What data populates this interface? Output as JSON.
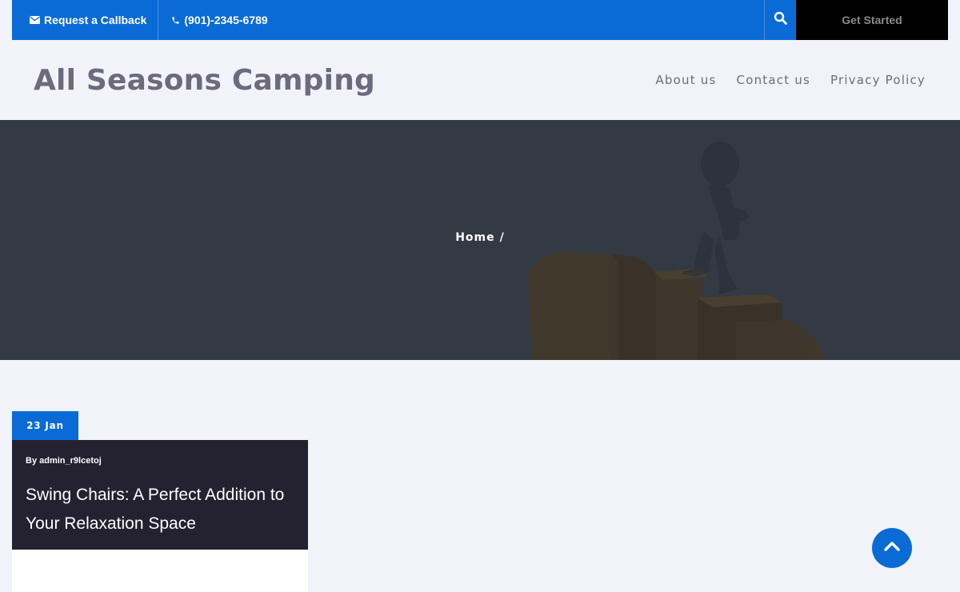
{
  "topbar": {
    "callback_label": "Request a Callback",
    "phone_label": "(901)-2345-6789",
    "cta_label": "Get Started"
  },
  "header": {
    "site_title": "All Seasons Camping",
    "nav": [
      {
        "label": "About us"
      },
      {
        "label": "Contact us"
      },
      {
        "label": "Privacy Policy"
      }
    ]
  },
  "hero": {
    "breadcrumb": {
      "home": "Home",
      "separator": "/"
    }
  },
  "post": {
    "date": "23 Jan",
    "author_meta": "By admin_r9lcetoj",
    "title": "Swing Chairs: A Perfect Addition to Your Relaxation Space"
  },
  "colors": {
    "accent": "#0b6bd6",
    "dark": "#242230",
    "hero_bg": "#333a44",
    "text_muted": "#6e6a7e"
  },
  "icons": [
    "envelope-icon",
    "phone-icon",
    "search-icon",
    "chevron-up-icon"
  ]
}
